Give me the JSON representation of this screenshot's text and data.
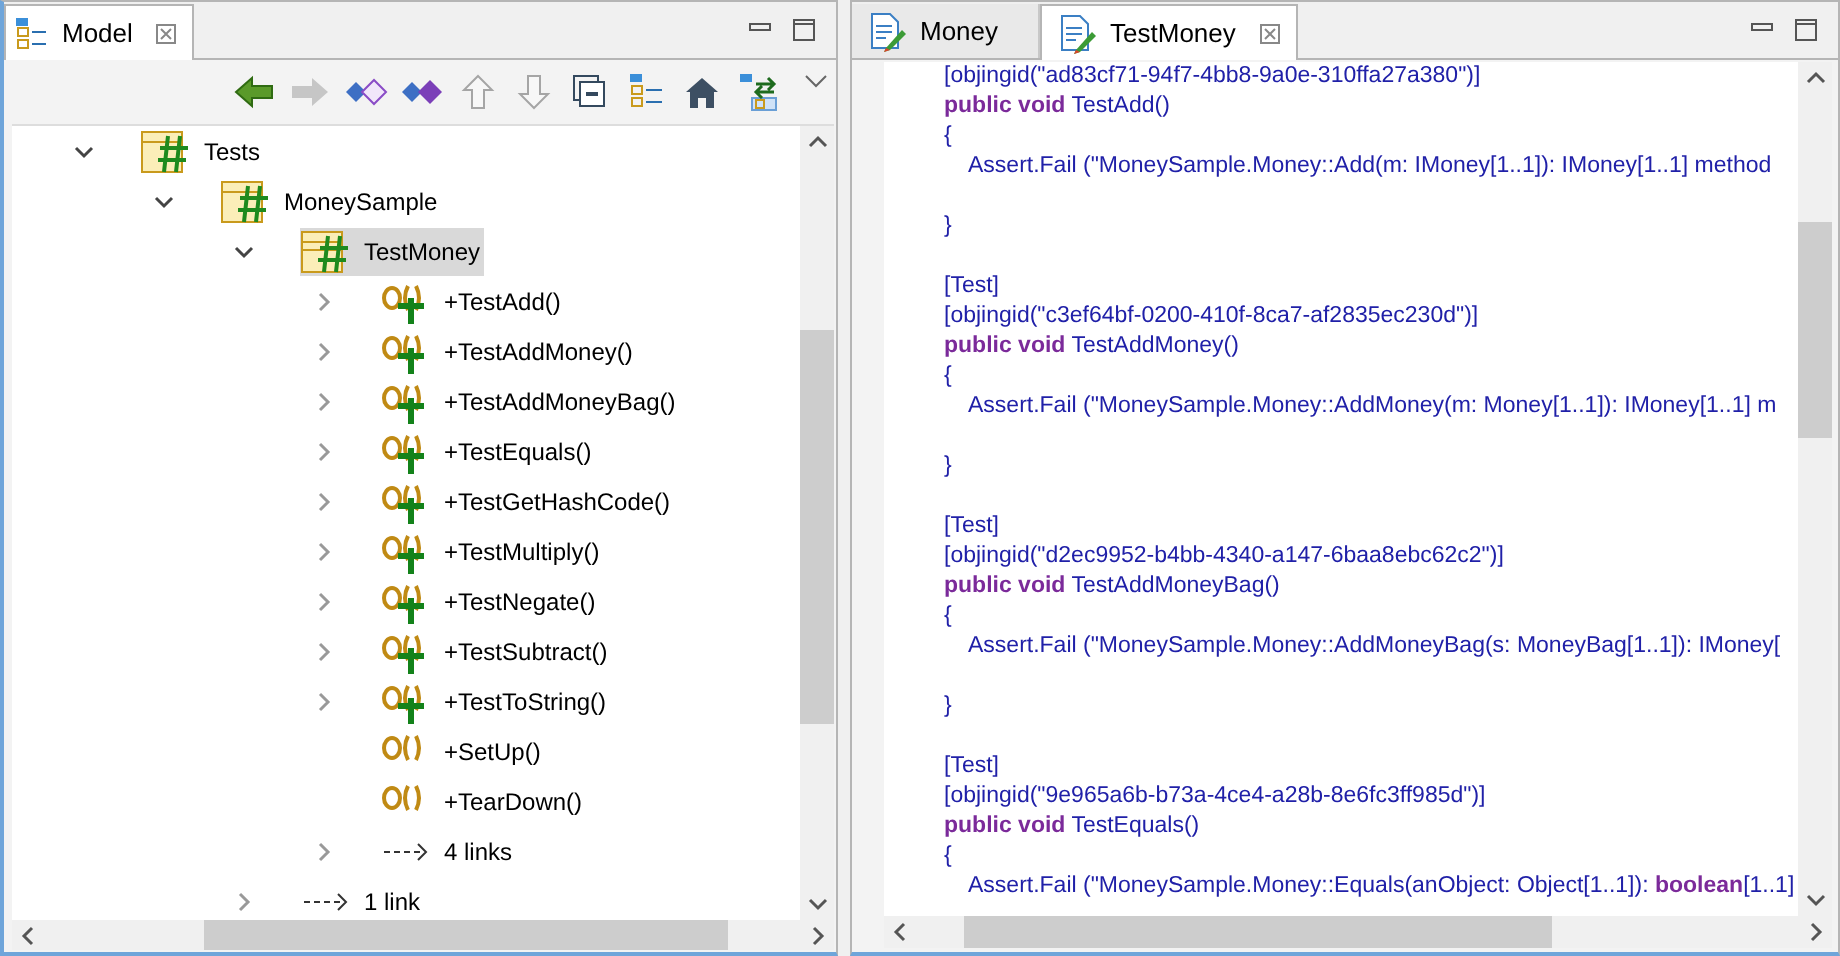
{
  "model_view": {
    "tab": {
      "label": "Model",
      "selected": true
    },
    "toolbar": [
      {
        "kind": "back",
        "disabled": false
      },
      {
        "kind": "forward",
        "disabled": true
      },
      {
        "kind": "diamond-outline",
        "disabled": false
      },
      {
        "kind": "diamond-filled",
        "disabled": false
      },
      {
        "kind": "up",
        "disabled": true
      },
      {
        "kind": "down",
        "disabled": true
      },
      {
        "kind": "collapse",
        "disabled": false
      },
      {
        "kind": "tree",
        "disabled": false
      },
      {
        "kind": "home",
        "disabled": false
      },
      {
        "kind": "sync",
        "disabled": false
      }
    ],
    "tree": [
      {
        "label": "Tests",
        "kind": "package",
        "expanded": true,
        "selected": false,
        "children": [
          {
            "label": "MoneySample",
            "kind": "package",
            "expanded": true,
            "selected": false,
            "children": [
              {
                "label": "TestMoney",
                "kind": "class",
                "expanded": true,
                "selected": true,
                "children": [
                  {
                    "label": "+TestAdd()",
                    "kind": "test-operation",
                    "expanded": false,
                    "selected": false
                  },
                  {
                    "label": "+TestAddMoney()",
                    "kind": "test-operation",
                    "expanded": false,
                    "selected": false
                  },
                  {
                    "label": "+TestAddMoneyBag()",
                    "kind": "test-operation",
                    "expanded": false,
                    "selected": false
                  },
                  {
                    "label": "+TestEquals()",
                    "kind": "test-operation",
                    "expanded": false,
                    "selected": false
                  },
                  {
                    "label": "+TestGetHashCode()",
                    "kind": "test-operation",
                    "expanded": false,
                    "selected": false
                  },
                  {
                    "label": "+TestMultiply()",
                    "kind": "test-operation",
                    "expanded": false,
                    "selected": false
                  },
                  {
                    "label": "+TestNegate()",
                    "kind": "test-operation",
                    "expanded": false,
                    "selected": false
                  },
                  {
                    "label": "+TestSubtract()",
                    "kind": "test-operation",
                    "expanded": false,
                    "selected": false
                  },
                  {
                    "label": "+TestToString()",
                    "kind": "test-operation",
                    "expanded": false,
                    "selected": false
                  },
                  {
                    "label": "+SetUp()",
                    "kind": "operation",
                    "selected": false
                  },
                  {
                    "label": "+TearDown()",
                    "kind": "operation",
                    "selected": false
                  },
                  {
                    "label": "4 links",
                    "kind": "links",
                    "expanded": false,
                    "selected": false
                  }
                ]
              },
              {
                "label": "1 link",
                "kind": "links",
                "expanded": false,
                "selected": false
              }
            ]
          }
        ]
      }
    ]
  },
  "editor": {
    "tabs": [
      {
        "label": "Money",
        "selected": false
      },
      {
        "label": "TestMoney",
        "selected": true
      }
    ],
    "lines": [
      {
        "kind": "code",
        "text": "[objingid(\"ad83cf71-94f7-4bb8-9a0e-310ffa27a380\")]"
      },
      {
        "kind": "code",
        "text": "**public void** TestAdd()"
      },
      {
        "kind": "code",
        "text": "{"
      },
      {
        "kind": "body",
        "text": "Assert.Fail (\"MoneySample.Money::Add(m: IMoney[1..1]): IMoney[1..1] method"
      },
      {
        "kind": "blank"
      },
      {
        "kind": "code",
        "text": "}"
      },
      {
        "kind": "blank"
      },
      {
        "kind": "code",
        "text": "[Test]"
      },
      {
        "kind": "code",
        "text": "[objingid(\"c3ef64bf-0200-410f-8ca7-af2835ec230d\")]"
      },
      {
        "kind": "code",
        "text": "**public void** TestAddMoney()"
      },
      {
        "kind": "code",
        "text": "{"
      },
      {
        "kind": "body",
        "text": "Assert.Fail (\"MoneySample.Money::AddMoney(m: Money[1..1]): IMoney[1..1] m"
      },
      {
        "kind": "blank"
      },
      {
        "kind": "code",
        "text": "}"
      },
      {
        "kind": "blank"
      },
      {
        "kind": "code",
        "text": "[Test]"
      },
      {
        "kind": "code",
        "text": "[objingid(\"d2ec9952-b4bb-4340-a147-6baa8ebc62c2\")]"
      },
      {
        "kind": "code",
        "text": "**public void** TestAddMoneyBag()"
      },
      {
        "kind": "code",
        "text": "{"
      },
      {
        "kind": "body",
        "text": "Assert.Fail (\"MoneySample.Money::AddMoneyBag(s: MoneyBag[1..1]): IMoney["
      },
      {
        "kind": "blank"
      },
      {
        "kind": "code",
        "text": "}"
      },
      {
        "kind": "blank"
      },
      {
        "kind": "code",
        "text": "[Test]"
      },
      {
        "kind": "code",
        "text": "[objingid(\"9e965a6b-b73a-4ce4-a28b-8e6fc3ff985d\")]"
      },
      {
        "kind": "code",
        "text": "**public void** TestEquals()"
      },
      {
        "kind": "code",
        "text": "{"
      },
      {
        "kind": "body",
        "text": "Assert.Fail (\"MoneySample.Money::Equals(anObject: Object[1..1]): **boolean**[1..1]"
      }
    ]
  }
}
